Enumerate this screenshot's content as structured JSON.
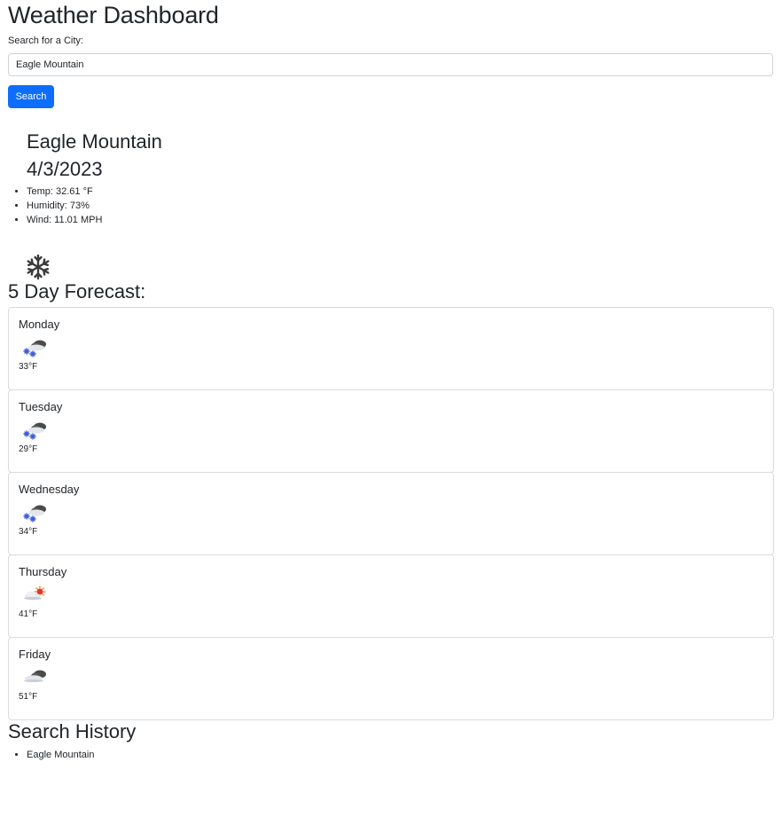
{
  "header": {
    "title": "Weather Dashboard"
  },
  "search": {
    "label": "Search for a City:",
    "value": "Eagle Mountain",
    "button_label": "Search"
  },
  "current": {
    "city": "Eagle Mountain",
    "date": "4/3/2023",
    "temp": "Temp: 32.61 °F",
    "humidity": "Humidity: 73%",
    "wind": "Wind: 11.01 MPH",
    "icon": "snowflake-icon"
  },
  "forecast": {
    "heading": "5 Day Forecast:",
    "days": [
      {
        "day": "Monday",
        "temp": "33°F",
        "icon": "snow-cloud-icon"
      },
      {
        "day": "Tuesday",
        "temp": "29°F",
        "icon": "snow-cloud-icon"
      },
      {
        "day": "Wednesday",
        "temp": "34°F",
        "icon": "snow-cloud-icon"
      },
      {
        "day": "Thursday",
        "temp": "41°F",
        "icon": "sun-behind-cloud-icon"
      },
      {
        "day": "Friday",
        "temp": "51°F",
        "icon": "cloud-icon"
      }
    ]
  },
  "history": {
    "heading": "Search History",
    "items": [
      "Eagle Mountain"
    ]
  },
  "colors": {
    "primary_button": "#0d6efd",
    "text": "#212529",
    "border": "#d9dcdf"
  }
}
